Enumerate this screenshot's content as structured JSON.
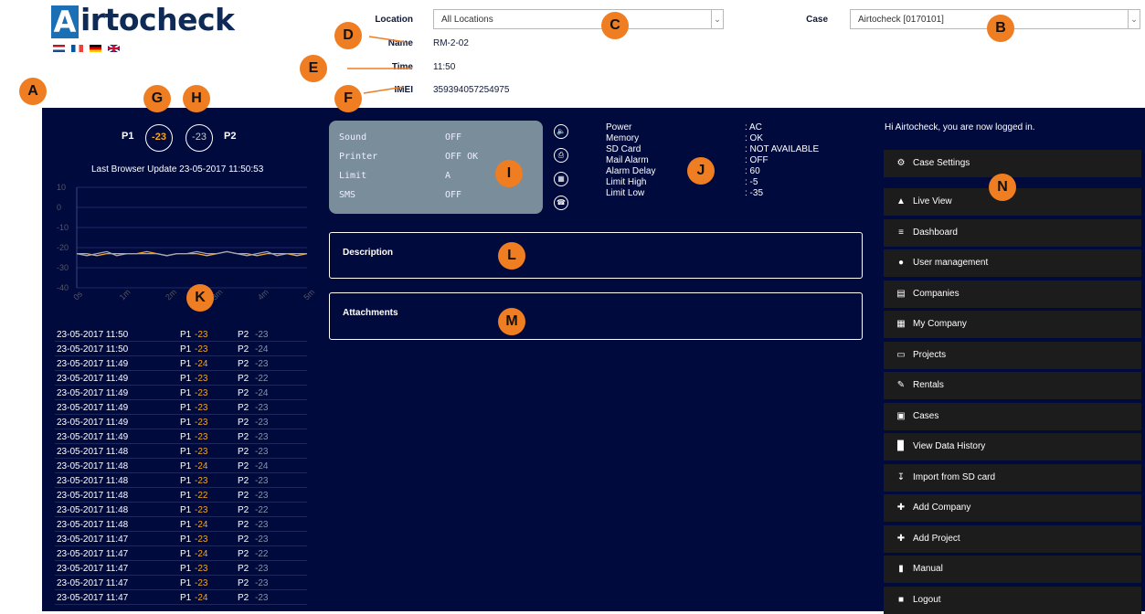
{
  "header": {
    "brand": "Airtocheck",
    "languages": [
      "nl",
      "fr",
      "de",
      "en"
    ],
    "location_label": "Location",
    "location_value": "All Locations",
    "case_label": "Case",
    "case_value": "Airtocheck [0170101]",
    "name_label": "Name",
    "name_value": "RM-2-02",
    "time_label": "Time",
    "time_value": "11:50",
    "imei_label": "IMEI",
    "imei_value": "359394057254975"
  },
  "probes": {
    "p1_label": "P1",
    "p1_value": "-23",
    "p2_label": "P2",
    "p2_value": "-23"
  },
  "chart_data": {
    "type": "line",
    "title": "Last Browser Update 23-05-2017 11:50:53",
    "y_ticks": [
      "10",
      "0",
      "-10",
      "-20",
      "-30",
      "-40"
    ],
    "x_ticks": [
      "0s",
      "1m",
      "2m",
      "3m",
      "4m",
      "5m"
    ],
    "ylim": [
      -40,
      10
    ],
    "grid": true,
    "series": [
      {
        "color": "#f5a623",
        "values": [
          -23,
          -23,
          -24,
          -23,
          -23,
          -23,
          -23,
          -22,
          -23,
          -24,
          -23,
          -23,
          -23,
          -24,
          -23,
          -22,
          -23,
          -23,
          -24,
          -23,
          -23,
          -23,
          -24,
          -23
        ]
      },
      {
        "color": "#a0a8b8",
        "values": [
          -23,
          -24,
          -23,
          -22,
          -24,
          -23,
          -23,
          -23,
          -23,
          -24,
          -23,
          -23,
          -22,
          -23,
          -23,
          -22,
          -23,
          -24,
          -23,
          -22,
          -24,
          -23,
          -23,
          -23
        ]
      }
    ]
  },
  "status": {
    "rows": [
      {
        "label": "Sound",
        "value": "OFF"
      },
      {
        "label": "Printer",
        "value": "OFF OK"
      },
      {
        "label": "Limit",
        "value": "A"
      },
      {
        "label": "SMS",
        "value": "OFF"
      }
    ],
    "icons": [
      "speaker-icon",
      "printer-icon",
      "memory-card-icon",
      "phone-icon"
    ]
  },
  "info": [
    {
      "key": "Power",
      "value": ": AC"
    },
    {
      "key": "Memory",
      "value": ": OK"
    },
    {
      "key": "SD Card",
      "value": ": NOT AVAILABLE"
    },
    {
      "key": "Mail Alarm",
      "value": ": OFF"
    },
    {
      "key": "Alarm Delay",
      "value": ": 60"
    },
    {
      "key": "Limit High",
      "value": ": -5"
    },
    {
      "key": "Limit Low",
      "value": ": -35"
    }
  ],
  "description_title": "Description",
  "attachments_title": "Attachments",
  "sidebar": {
    "greeting": "Hi Airtocheck, you are now logged in.",
    "case_settings": "Case Settings",
    "items": [
      {
        "label": "Live View",
        "icon": "area-chart-icon"
      },
      {
        "label": "Dashboard",
        "icon": "menu-lines-icon"
      },
      {
        "label": "User management",
        "icon": "user-icon"
      },
      {
        "label": "Companies",
        "icon": "industry-icon"
      },
      {
        "label": "My Company",
        "icon": "building-icon"
      },
      {
        "label": "Projects",
        "icon": "monitor-icon"
      },
      {
        "label": "Rentals",
        "icon": "edit-square-icon"
      },
      {
        "label": "Cases",
        "icon": "briefcase-icon"
      },
      {
        "label": "View Data History",
        "icon": "bar-chart-icon"
      },
      {
        "label": "Import from SD card",
        "icon": "download-icon"
      },
      {
        "label": "Add Company",
        "icon": "plus-icon"
      },
      {
        "label": "Add Project",
        "icon": "plus-icon"
      },
      {
        "label": "Manual",
        "icon": "book-icon"
      },
      {
        "label": "Logout",
        "icon": "lock-icon"
      }
    ]
  },
  "log": [
    {
      "time": "23-05-2017 11:50",
      "p1": "-23",
      "p2": "-23"
    },
    {
      "time": "23-05-2017 11:50",
      "p1": "-23",
      "p2": "-24"
    },
    {
      "time": "23-05-2017 11:49",
      "p1": "-24",
      "p2": "-23"
    },
    {
      "time": "23-05-2017 11:49",
      "p1": "-23",
      "p2": "-22"
    },
    {
      "time": "23-05-2017 11:49",
      "p1": "-23",
      "p2": "-24"
    },
    {
      "time": "23-05-2017 11:49",
      "p1": "-23",
      "p2": "-23"
    },
    {
      "time": "23-05-2017 11:49",
      "p1": "-23",
      "p2": "-23"
    },
    {
      "time": "23-05-2017 11:49",
      "p1": "-23",
      "p2": "-23"
    },
    {
      "time": "23-05-2017 11:48",
      "p1": "-23",
      "p2": "-23"
    },
    {
      "time": "23-05-2017 11:48",
      "p1": "-24",
      "p2": "-24"
    },
    {
      "time": "23-05-2017 11:48",
      "p1": "-23",
      "p2": "-23"
    },
    {
      "time": "23-05-2017 11:48",
      "p1": "-22",
      "p2": "-23"
    },
    {
      "time": "23-05-2017 11:48",
      "p1": "-23",
      "p2": "-22"
    },
    {
      "time": "23-05-2017 11:48",
      "p1": "-24",
      "p2": "-23"
    },
    {
      "time": "23-05-2017 11:47",
      "p1": "-23",
      "p2": "-23"
    },
    {
      "time": "23-05-2017 11:47",
      "p1": "-24",
      "p2": "-22"
    },
    {
      "time": "23-05-2017 11:47",
      "p1": "-23",
      "p2": "-23"
    },
    {
      "time": "23-05-2017 11:47",
      "p1": "-23",
      "p2": "-23"
    },
    {
      "time": "23-05-2017 11:47",
      "p1": "-24",
      "p2": "-23"
    }
  ],
  "markers": [
    "A",
    "B",
    "C",
    "D",
    "E",
    "F",
    "G",
    "H",
    "I",
    "J",
    "K",
    "L",
    "M",
    "N"
  ],
  "colors": {
    "main_bg": "#000a3c",
    "accent": "#ef7d22",
    "p1": "#f5a623",
    "sidebar_item": "#1c1c1c"
  }
}
